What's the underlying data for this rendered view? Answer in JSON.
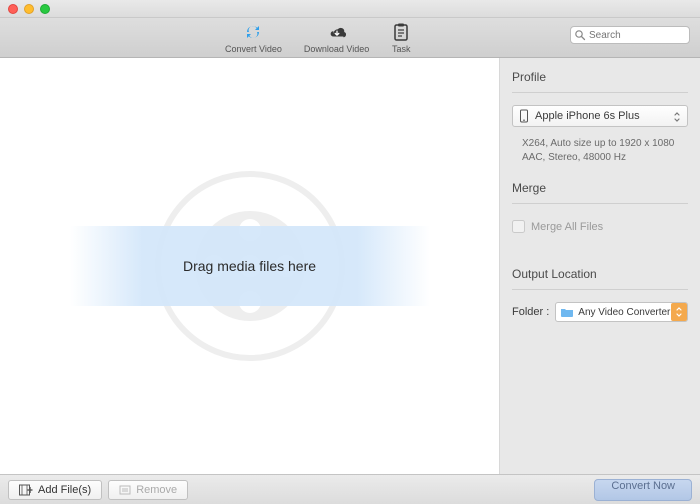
{
  "toolbar": {
    "convert_label": "Convert Video",
    "download_label": "Download Video",
    "task_label": "Task",
    "search_placeholder": "Search"
  },
  "dropzone": {
    "text": "Drag media files here"
  },
  "sidebar": {
    "profile_title": "Profile",
    "profile_value": "Apple iPhone 6s Plus",
    "profile_desc_line1": "X264, Auto size up to 1920 x 1080",
    "profile_desc_line2": "AAC, Stereo, 48000 Hz",
    "merge_title": "Merge",
    "merge_checkbox_label": "Merge All Files",
    "output_title": "Output Location",
    "folder_label": "Folder :",
    "folder_value": "Any Video Converter"
  },
  "footer": {
    "add_files_label": "Add File(s)",
    "remove_label": "Remove",
    "convert_label": "Convert Now"
  },
  "colors": {
    "accent_blue": "#2f9fea",
    "accent_orange": "#f4a94d"
  }
}
